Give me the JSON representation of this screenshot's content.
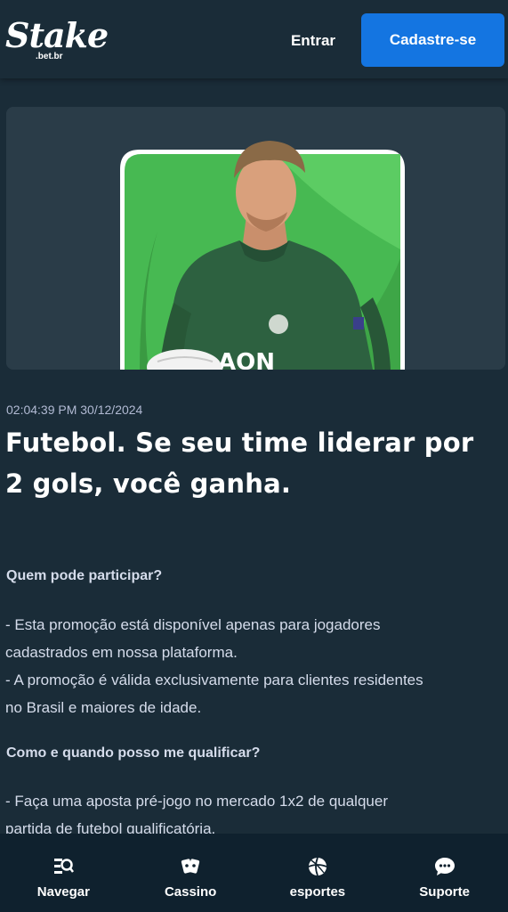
{
  "header": {
    "logo_text": "Stake",
    "logo_sub": ".bet.br",
    "login_label": "Entrar",
    "register_label": "Cadastre-se"
  },
  "article": {
    "timestamp": "02:04:39 PM 30/12/2024",
    "title": "Futebol. Se seu time liderar por 2 gols, você ganha.",
    "sections": [
      {
        "heading": "Quem pode participar?",
        "lines": [
          "- Esta promoção está disponível apenas para jogadores",
          "cadastrados em nossa plataforma.",
          "- A promoção é válida exclusivamente para clientes residentes",
          "no Brasil e maiores de idade."
        ]
      },
      {
        "heading": "Como e quando posso me qualificar?",
        "lines": [
          "- Faça uma aposta pré-jogo no mercado 1x2 de qualquer",
          "partida de futebol qualificatória."
        ]
      }
    ],
    "hero": {
      "shirt_sponsor": "AON"
    }
  },
  "bottom_nav": [
    {
      "label": "Navegar",
      "icon": "browse-icon"
    },
    {
      "label": "Cassino",
      "icon": "cards-icon"
    },
    {
      "label": "esportes",
      "icon": "sports-ball-icon"
    },
    {
      "label": "Suporte",
      "icon": "chat-icon"
    }
  ],
  "colors": {
    "background": "#1a2c38",
    "nav_background": "#0f212e",
    "accent": "#1475e1",
    "hero_green": "#47b952"
  }
}
